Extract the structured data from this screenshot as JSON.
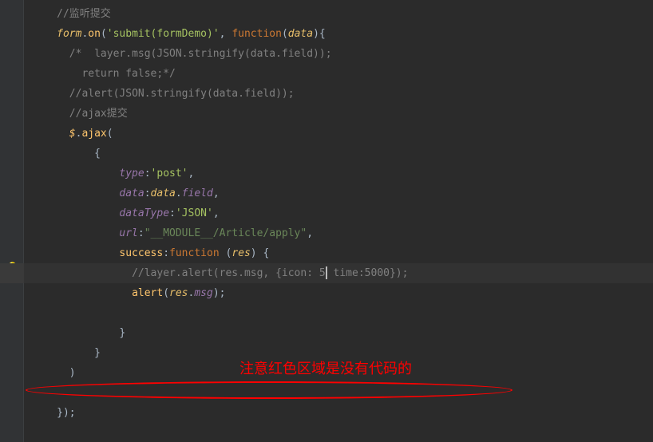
{
  "code": {
    "line1_comment": "//监听提交",
    "line2_form": "form",
    "line2_on": "on",
    "line2_submit": "'submit(formDemo)'",
    "line2_function": "function",
    "line2_data": "data",
    "line3_comment1": "/*  layer.msg(JSON.stringify(data.field));",
    "line4_comment": "         return false;*/",
    "line5_comment": "//alert(JSON.stringify(data.field));",
    "line6_comment": "//ajax提交",
    "line7_jquery": "$",
    "line7_ajax": "ajax",
    "line8_brace": "{",
    "line9_type": "type",
    "line9_post": "'post'",
    "line10_data": "data",
    "line10_data2": "data",
    "line10_field": "field",
    "line11_dataType": "dataType",
    "line11_json": "'JSON'",
    "line12_url": "url",
    "line12_urlval": "\"__MODULE__/Article/apply\"",
    "line13_success": "success",
    "line13_function": "function",
    "line13_res": "res",
    "line14_comment_a": "//layer.alert(res.msg, {icon: 5",
    "line14_comment_b": " time:5000});",
    "line15_alert": "alert",
    "line15_res": "res",
    "line15_msg": "msg",
    "line17_brace": "}",
    "line18_brace": "}",
    "line19_paren": ")",
    "line21_close": "});"
  },
  "annotation": {
    "text": "注意红色区域是没有代码的"
  }
}
